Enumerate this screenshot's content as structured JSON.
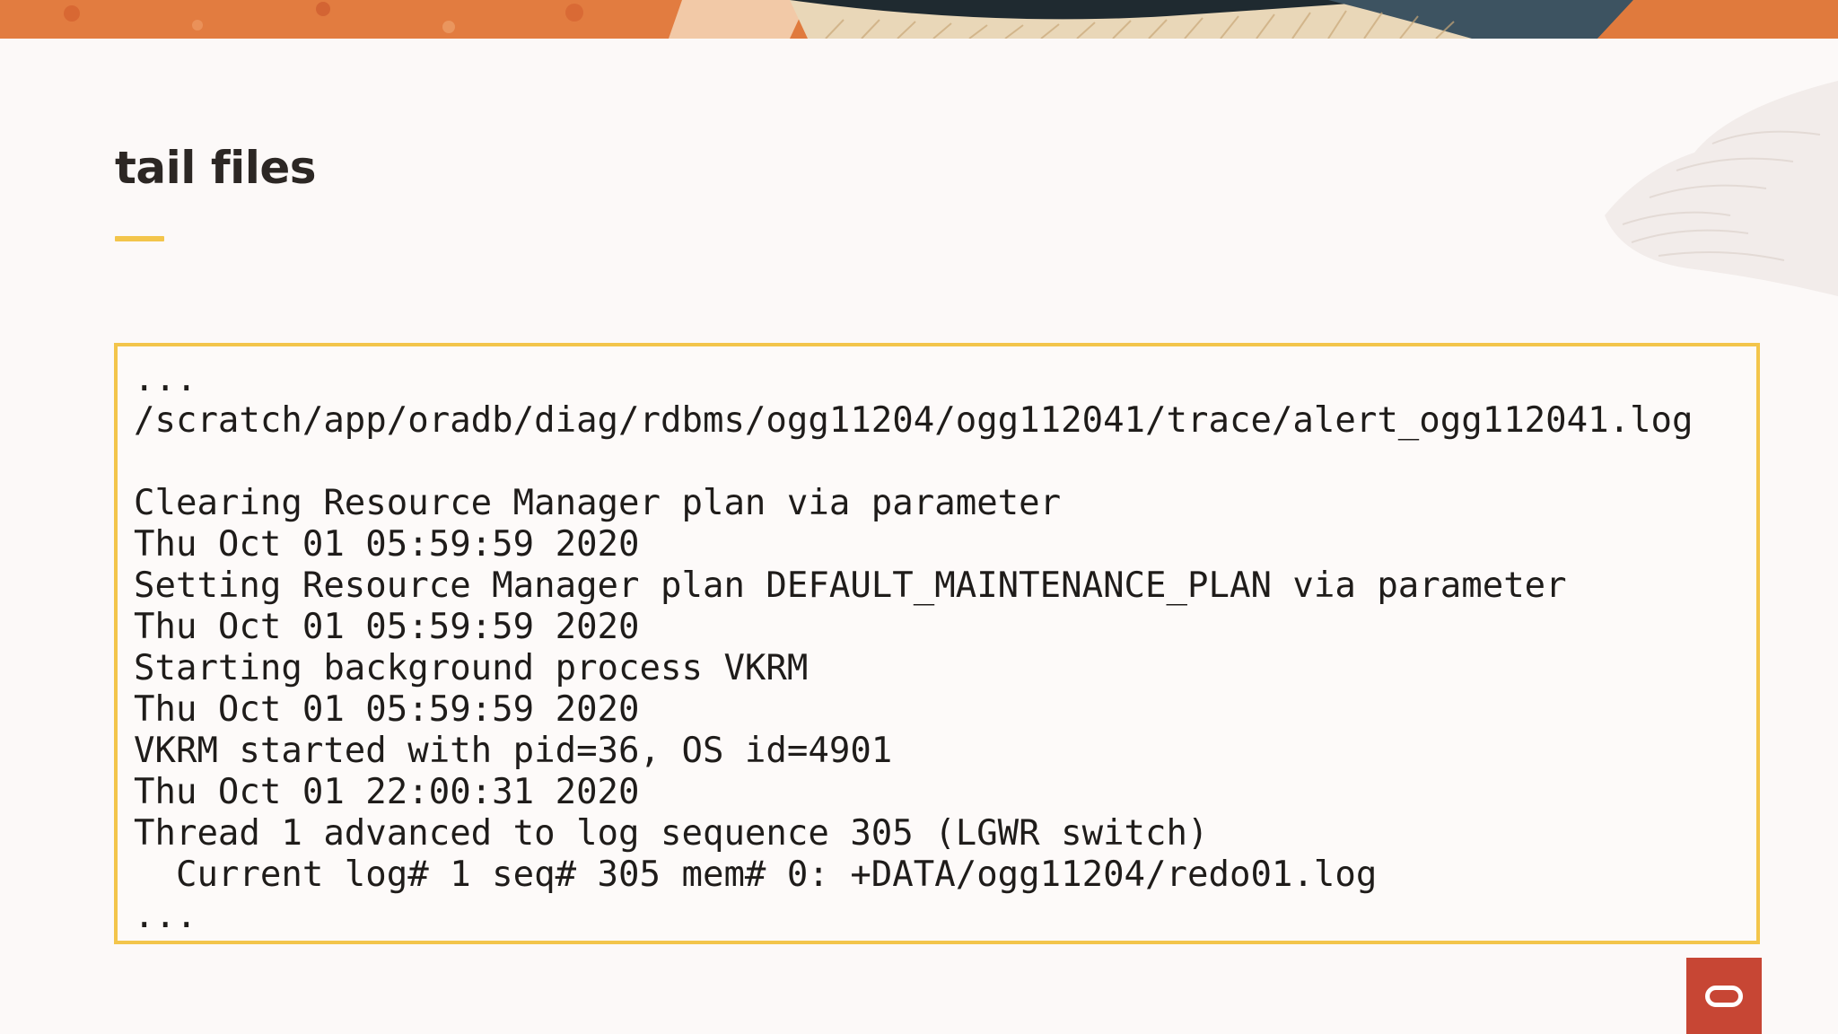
{
  "slide": {
    "title": "tail files",
    "accent_color": "#f3c54b",
    "banner_colors": [
      "#e07a3d",
      "#c9552b",
      "#2c3e4a",
      "#e9d7b8"
    ]
  },
  "code_block": {
    "lines": [
      "...",
      "/scratch/app/oradb/diag/rdbms/ogg11204/ogg112041/trace/alert_ogg112041.log",
      "",
      "Clearing Resource Manager plan via parameter",
      "Thu Oct 01 05:59:59 2020",
      "Setting Resource Manager plan DEFAULT_MAINTENANCE_PLAN via parameter",
      "Thu Oct 01 05:59:59 2020",
      "Starting background process VKRM",
      "Thu Oct 01 05:59:59 2020",
      "VKRM started with pid=36, OS id=4901",
      "Thu Oct 01 22:00:31 2020",
      "Thread 1 advanced to log sequence 305 (LGWR switch)",
      "  Current log# 1 seq# 305 mem# 0: +DATA/ogg11204/redo01.log",
      "..."
    ]
  },
  "logo": {
    "icon": "oracle-logo-icon",
    "color": "#c74634"
  }
}
